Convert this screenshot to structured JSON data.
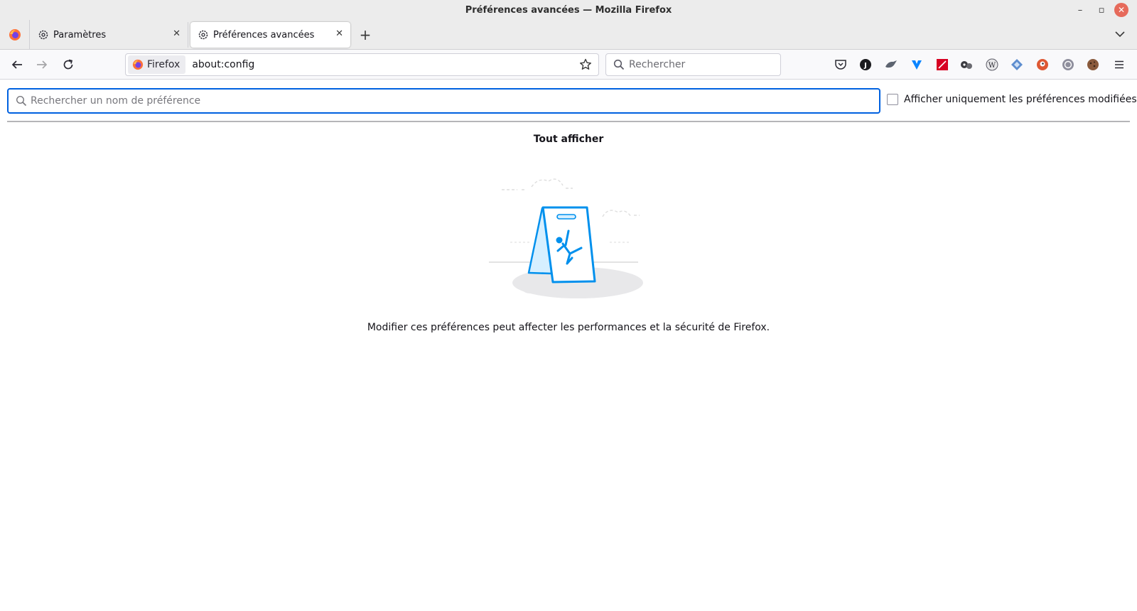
{
  "window": {
    "title": "Préférences avancées — Mozilla Firefox",
    "controls": {
      "minimize": "–",
      "maximize": "▫",
      "close": "✕"
    }
  },
  "tabs": [
    {
      "label": "Paramètres",
      "icon": "gear-icon",
      "close": "✕",
      "active": false
    },
    {
      "label": "Préférences avancées",
      "icon": "gear-icon",
      "close": "✕",
      "active": true
    }
  ],
  "tabstrip": {
    "new_tab": "+",
    "list_all_tabs": "chevron-down-icon"
  },
  "navbar": {
    "identity_label": "Firefox",
    "url": "about:config",
    "search_placeholder": "Rechercher",
    "extensions": [
      "pocket-icon",
      "joplin-icon",
      "bird-icon",
      "vpn-icon",
      "pdf-icon",
      "gears-icon",
      "wikipedia-icon",
      "diamond-icon",
      "duckduckgo-icon",
      "tor-icon",
      "cookie-icon"
    ]
  },
  "content": {
    "pref_search_placeholder": "Rechercher un nom de préférence",
    "show_modified_label": "Afficher uniquement les préférences modifiées",
    "show_modified_checked": false,
    "show_all": "Tout afficher",
    "warning": "Modifier ces préférences peut affecter les performances et la sécurité de Firefox."
  },
  "colors": {
    "focus_ring": "#0061e0",
    "illustration_blue": "#0090ed",
    "illustration_fill": "#d6efff"
  }
}
